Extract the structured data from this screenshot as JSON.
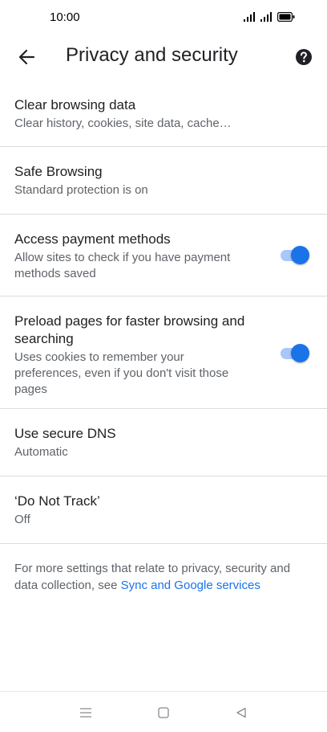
{
  "status_bar": {
    "time": "10:00"
  },
  "header": {
    "title": "Privacy and security",
    "back_icon": "arrow-left-icon",
    "help_icon": "help-circle-icon"
  },
  "items": [
    {
      "title": "Clear browsing data",
      "subtitle": "Clear history, cookies, site data, cache…"
    },
    {
      "title": "Safe Browsing",
      "subtitle": "Standard protection is on"
    },
    {
      "title": "Access payment methods",
      "subtitle": "Allow sites to check if you have payment methods saved",
      "toggle_on": true
    },
    {
      "title": "Preload pages for faster browsing and searching",
      "subtitle": "Uses cookies to remember your preferences, even if you don't visit those pages",
      "toggle_on": true
    },
    {
      "title": "Use secure DNS",
      "subtitle": "Automatic"
    },
    {
      "title": "‘Do Not Track’",
      "subtitle": "Off"
    }
  ],
  "footer": {
    "text": "For more settings that relate to privacy, security and data collection, see ",
    "link": "Sync and Google services"
  },
  "colors": {
    "accent": "#1a73e8",
    "toggle_track": "#a8c7fa",
    "divider": "#dadce0"
  }
}
